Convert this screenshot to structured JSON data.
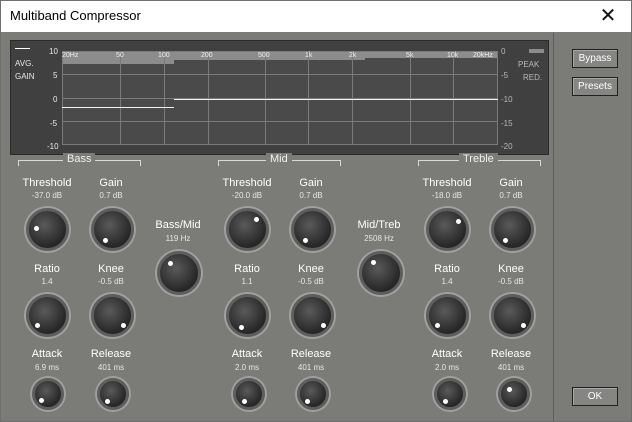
{
  "window": {
    "title": "Multiband Compressor",
    "close_glyph": "✕"
  },
  "display": {
    "left_label_1": "AVG.",
    "left_label_2": "GAIN",
    "right_label_1": "PEAK",
    "right_label_2": "RED.",
    "left_scale": [
      "10",
      "5",
      "0",
      "-5",
      "-10"
    ],
    "right_scale": [
      "0",
      "-5",
      "-10",
      "-15",
      "-20"
    ],
    "freq_labels": [
      "20Hz",
      "50",
      "100",
      "200",
      "500",
      "1k",
      "2k",
      "5k",
      "10k",
      "20kHz"
    ]
  },
  "sections": {
    "bass": {
      "title": "Bass",
      "threshold": {
        "label": "Threshold",
        "value": "-37.0 dB"
      },
      "gain": {
        "label": "Gain",
        "value": "0.7 dB"
      },
      "ratio": {
        "label": "Ratio",
        "value": "1.4"
      },
      "knee": {
        "label": "Knee",
        "value": "-0.5 dB"
      },
      "attack": {
        "label": "Attack",
        "value": "6.9 ms"
      },
      "release": {
        "label": "Release",
        "value": "401 ms"
      }
    },
    "crossover_low": {
      "label": "Bass/Mid",
      "value": "119 Hz"
    },
    "mid": {
      "title": "Mid",
      "threshold": {
        "label": "Threshold",
        "value": "-20.0 dB"
      },
      "gain": {
        "label": "Gain",
        "value": "0.7 dB"
      },
      "ratio": {
        "label": "Ratio",
        "value": "1.1"
      },
      "knee": {
        "label": "Knee",
        "value": "-0.5 dB"
      },
      "attack": {
        "label": "Attack",
        "value": "2.0 ms"
      },
      "release": {
        "label": "Release",
        "value": "401 ms"
      }
    },
    "crossover_high": {
      "label": "Mid/Treb",
      "value": "2508 Hz"
    },
    "treble": {
      "title": "Treble",
      "threshold": {
        "label": "Threshold",
        "value": "-18.0 dB"
      },
      "gain": {
        "label": "Gain",
        "value": "0.7 dB"
      },
      "ratio": {
        "label": "Ratio",
        "value": "1.4"
      },
      "knee": {
        "label": "Knee",
        "value": "-0.5 dB"
      },
      "attack": {
        "label": "Attack",
        "value": "2.0 ms"
      },
      "release": {
        "label": "Release",
        "value": "401 ms"
      }
    }
  },
  "side_panel": {
    "bypass": "Bypass",
    "presets": "Presets",
    "ok": "OK"
  }
}
